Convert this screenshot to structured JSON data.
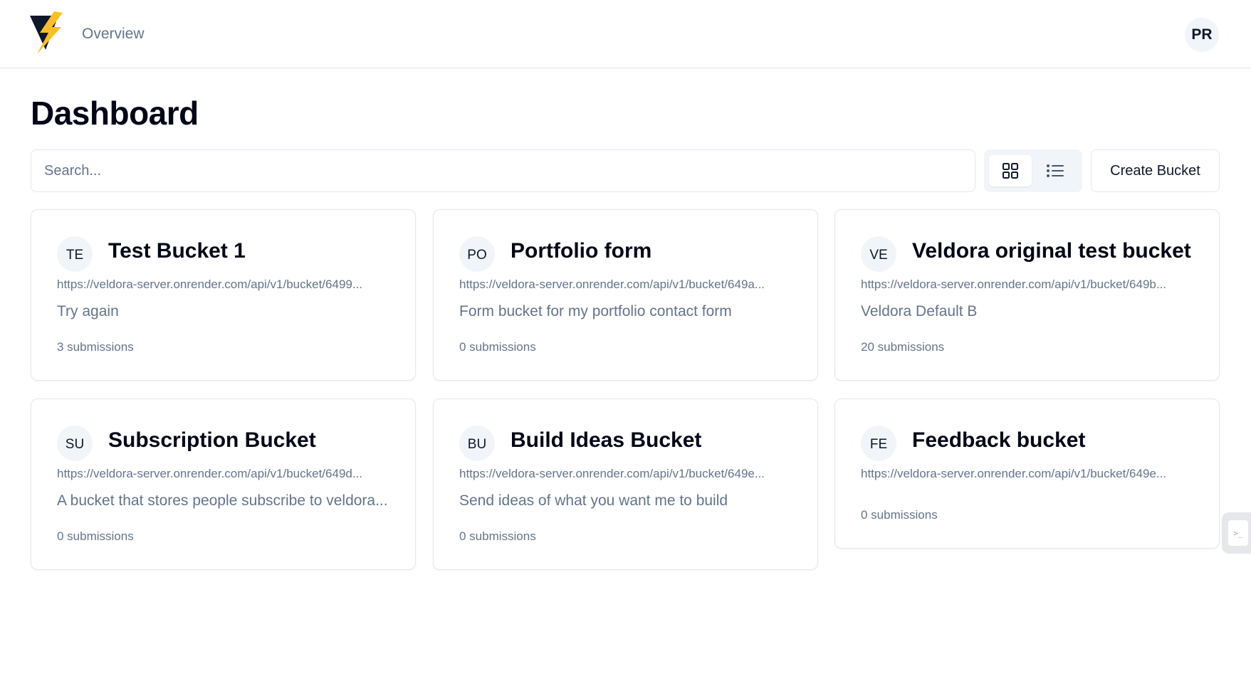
{
  "header": {
    "nav_overview": "Overview",
    "user_initials": "PR"
  },
  "page": {
    "title": "Dashboard"
  },
  "toolbar": {
    "search_placeholder": "Search...",
    "create_label": "Create Bucket",
    "active_view": "grid"
  },
  "buckets": [
    {
      "initials": "TE",
      "name": "Test Bucket 1",
      "url": "https://veldora-server.onrender.com/api/v1/bucket/6499...",
      "description": "Try again",
      "submissions": "3 submissions"
    },
    {
      "initials": "PO",
      "name": "Portfolio form",
      "url": "https://veldora-server.onrender.com/api/v1/bucket/649a...",
      "description": "Form bucket for my portfolio contact form",
      "submissions": "0 submissions"
    },
    {
      "initials": "VE",
      "name": "Veldora original test bucket",
      "url": "https://veldora-server.onrender.com/api/v1/bucket/649b...",
      "description": "Veldora Default B",
      "submissions": "20 submissions"
    },
    {
      "initials": "SU",
      "name": "Subscription Bucket",
      "url": "https://veldora-server.onrender.com/api/v1/bucket/649d...",
      "description": "A bucket that stores people subscribe to veldora...",
      "submissions": "0 submissions"
    },
    {
      "initials": "BU",
      "name": "Build Ideas Bucket",
      "url": "https://veldora-server.onrender.com/api/v1/bucket/649e...",
      "description": "Send ideas of what you want me to build",
      "submissions": "0 submissions"
    },
    {
      "initials": "FE",
      "name": "Feedback bucket",
      "url": "https://veldora-server.onrender.com/api/v1/bucket/649e...",
      "description": "",
      "submissions": "0 submissions"
    }
  ],
  "colors": {
    "logo_dark": "#0f172a",
    "logo_bolt": "#fbbf24",
    "muted_text": "#64748b",
    "border": "#e2e8f0"
  }
}
